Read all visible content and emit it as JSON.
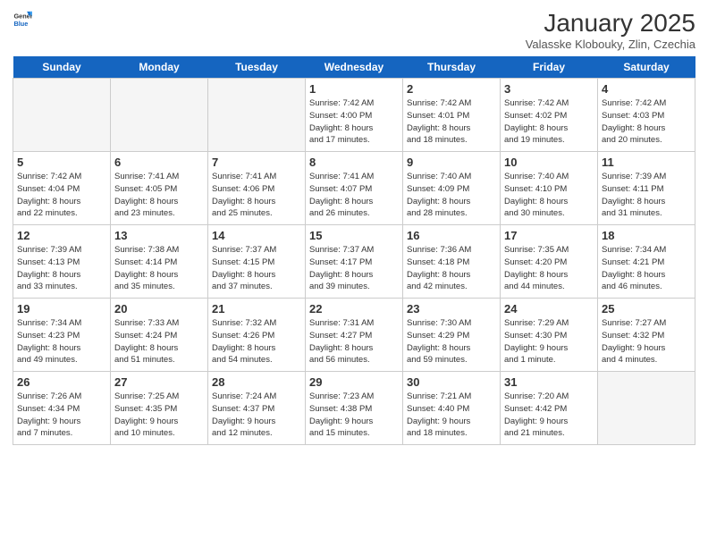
{
  "header": {
    "logo_general": "General",
    "logo_blue": "Blue",
    "title": "January 2025",
    "subtitle": "Valasske Klobouky, Zlin, Czechia"
  },
  "days_of_week": [
    "Sunday",
    "Monday",
    "Tuesday",
    "Wednesday",
    "Thursday",
    "Friday",
    "Saturday"
  ],
  "weeks": [
    [
      {
        "day": "",
        "info": ""
      },
      {
        "day": "",
        "info": ""
      },
      {
        "day": "",
        "info": ""
      },
      {
        "day": "1",
        "info": "Sunrise: 7:42 AM\nSunset: 4:00 PM\nDaylight: 8 hours\nand 17 minutes."
      },
      {
        "day": "2",
        "info": "Sunrise: 7:42 AM\nSunset: 4:01 PM\nDaylight: 8 hours\nand 18 minutes."
      },
      {
        "day": "3",
        "info": "Sunrise: 7:42 AM\nSunset: 4:02 PM\nDaylight: 8 hours\nand 19 minutes."
      },
      {
        "day": "4",
        "info": "Sunrise: 7:42 AM\nSunset: 4:03 PM\nDaylight: 8 hours\nand 20 minutes."
      }
    ],
    [
      {
        "day": "5",
        "info": "Sunrise: 7:42 AM\nSunset: 4:04 PM\nDaylight: 8 hours\nand 22 minutes."
      },
      {
        "day": "6",
        "info": "Sunrise: 7:41 AM\nSunset: 4:05 PM\nDaylight: 8 hours\nand 23 minutes."
      },
      {
        "day": "7",
        "info": "Sunrise: 7:41 AM\nSunset: 4:06 PM\nDaylight: 8 hours\nand 25 minutes."
      },
      {
        "day": "8",
        "info": "Sunrise: 7:41 AM\nSunset: 4:07 PM\nDaylight: 8 hours\nand 26 minutes."
      },
      {
        "day": "9",
        "info": "Sunrise: 7:40 AM\nSunset: 4:09 PM\nDaylight: 8 hours\nand 28 minutes."
      },
      {
        "day": "10",
        "info": "Sunrise: 7:40 AM\nSunset: 4:10 PM\nDaylight: 8 hours\nand 30 minutes."
      },
      {
        "day": "11",
        "info": "Sunrise: 7:39 AM\nSunset: 4:11 PM\nDaylight: 8 hours\nand 31 minutes."
      }
    ],
    [
      {
        "day": "12",
        "info": "Sunrise: 7:39 AM\nSunset: 4:13 PM\nDaylight: 8 hours\nand 33 minutes."
      },
      {
        "day": "13",
        "info": "Sunrise: 7:38 AM\nSunset: 4:14 PM\nDaylight: 8 hours\nand 35 minutes."
      },
      {
        "day": "14",
        "info": "Sunrise: 7:37 AM\nSunset: 4:15 PM\nDaylight: 8 hours\nand 37 minutes."
      },
      {
        "day": "15",
        "info": "Sunrise: 7:37 AM\nSunset: 4:17 PM\nDaylight: 8 hours\nand 39 minutes."
      },
      {
        "day": "16",
        "info": "Sunrise: 7:36 AM\nSunset: 4:18 PM\nDaylight: 8 hours\nand 42 minutes."
      },
      {
        "day": "17",
        "info": "Sunrise: 7:35 AM\nSunset: 4:20 PM\nDaylight: 8 hours\nand 44 minutes."
      },
      {
        "day": "18",
        "info": "Sunrise: 7:34 AM\nSunset: 4:21 PM\nDaylight: 8 hours\nand 46 minutes."
      }
    ],
    [
      {
        "day": "19",
        "info": "Sunrise: 7:34 AM\nSunset: 4:23 PM\nDaylight: 8 hours\nand 49 minutes."
      },
      {
        "day": "20",
        "info": "Sunrise: 7:33 AM\nSunset: 4:24 PM\nDaylight: 8 hours\nand 51 minutes."
      },
      {
        "day": "21",
        "info": "Sunrise: 7:32 AM\nSunset: 4:26 PM\nDaylight: 8 hours\nand 54 minutes."
      },
      {
        "day": "22",
        "info": "Sunrise: 7:31 AM\nSunset: 4:27 PM\nDaylight: 8 hours\nand 56 minutes."
      },
      {
        "day": "23",
        "info": "Sunrise: 7:30 AM\nSunset: 4:29 PM\nDaylight: 8 hours\nand 59 minutes."
      },
      {
        "day": "24",
        "info": "Sunrise: 7:29 AM\nSunset: 4:30 PM\nDaylight: 9 hours\nand 1 minute."
      },
      {
        "day": "25",
        "info": "Sunrise: 7:27 AM\nSunset: 4:32 PM\nDaylight: 9 hours\nand 4 minutes."
      }
    ],
    [
      {
        "day": "26",
        "info": "Sunrise: 7:26 AM\nSunset: 4:34 PM\nDaylight: 9 hours\nand 7 minutes."
      },
      {
        "day": "27",
        "info": "Sunrise: 7:25 AM\nSunset: 4:35 PM\nDaylight: 9 hours\nand 10 minutes."
      },
      {
        "day": "28",
        "info": "Sunrise: 7:24 AM\nSunset: 4:37 PM\nDaylight: 9 hours\nand 12 minutes."
      },
      {
        "day": "29",
        "info": "Sunrise: 7:23 AM\nSunset: 4:38 PM\nDaylight: 9 hours\nand 15 minutes."
      },
      {
        "day": "30",
        "info": "Sunrise: 7:21 AM\nSunset: 4:40 PM\nDaylight: 9 hours\nand 18 minutes."
      },
      {
        "day": "31",
        "info": "Sunrise: 7:20 AM\nSunset: 4:42 PM\nDaylight: 9 hours\nand 21 minutes."
      },
      {
        "day": "",
        "info": ""
      }
    ]
  ]
}
